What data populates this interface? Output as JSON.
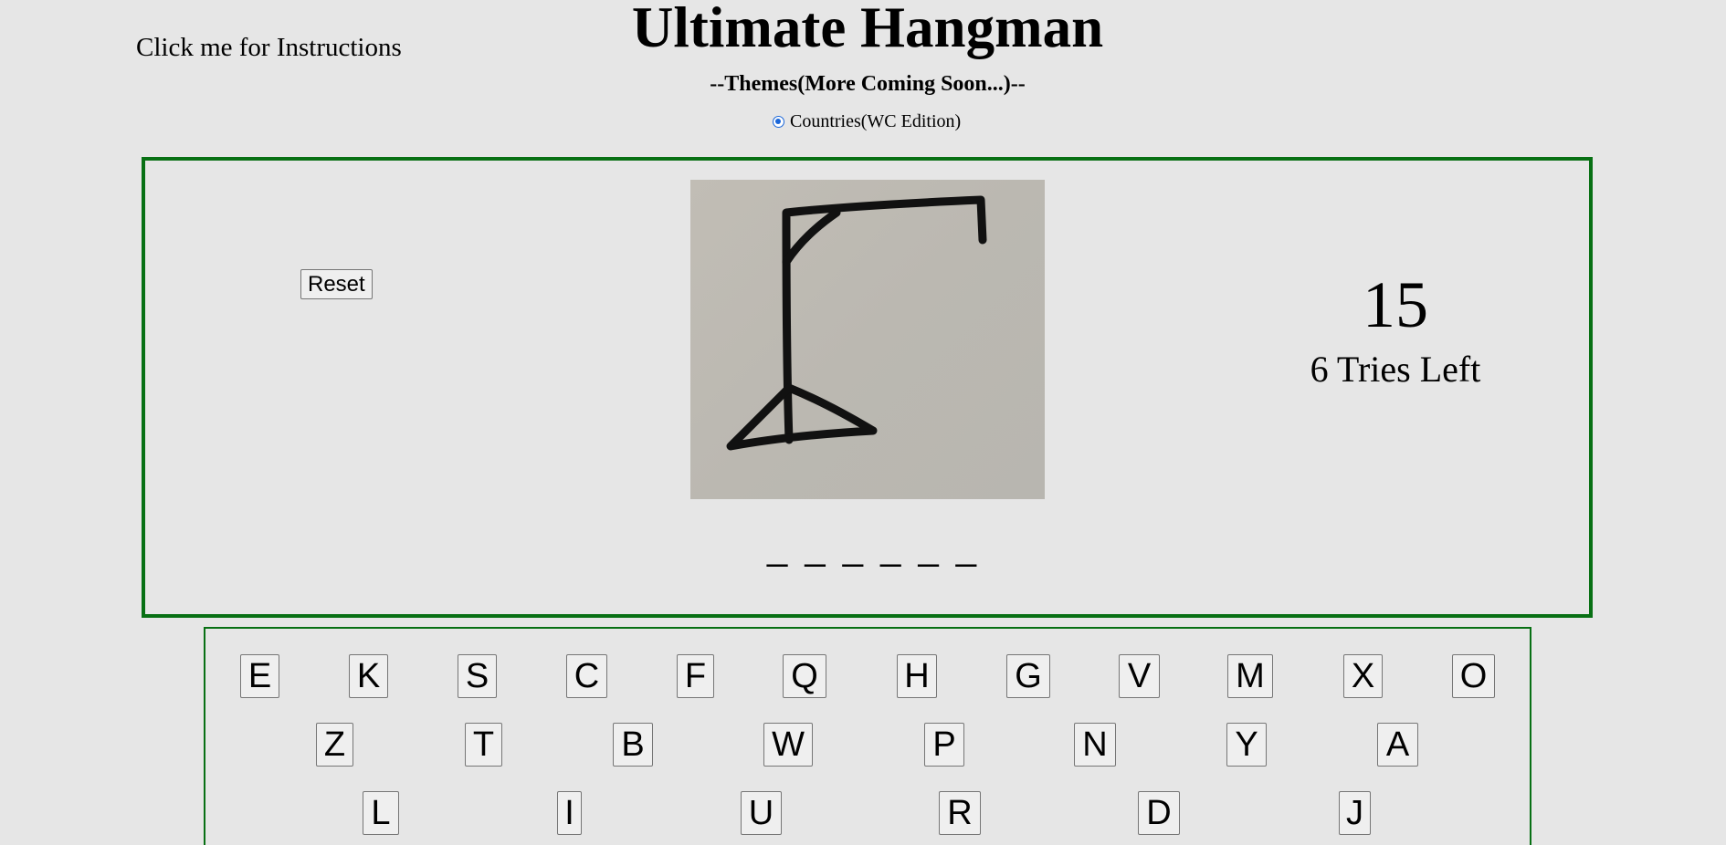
{
  "header": {
    "instructions_link": "Click me for Instructions",
    "title": "Ultimate Hangman",
    "themes_heading": "--Themes(More Coming Soon...)--",
    "theme_option_label": "Countries(WC Edition)",
    "theme_option_selected": true
  },
  "game": {
    "reset_label": "Reset",
    "word_blanks": "_ _ _ _ _ _",
    "score": "15",
    "tries_left": "6 Tries Left",
    "hangman_stage_icon": "gallows-icon"
  },
  "keyboard": {
    "rows": [
      [
        "E",
        "K",
        "S",
        "C",
        "F",
        "Q",
        "H",
        "G",
        "V",
        "M",
        "X",
        "O"
      ],
      [
        "Z",
        "T",
        "B",
        "W",
        "P",
        "N",
        "Y",
        "A"
      ],
      [
        "L",
        "I",
        "U",
        "R",
        "D",
        "J"
      ]
    ]
  },
  "colors": {
    "background": "#e6e6e6",
    "border_green": "#087014",
    "radio_blue": "#1a66d9"
  }
}
